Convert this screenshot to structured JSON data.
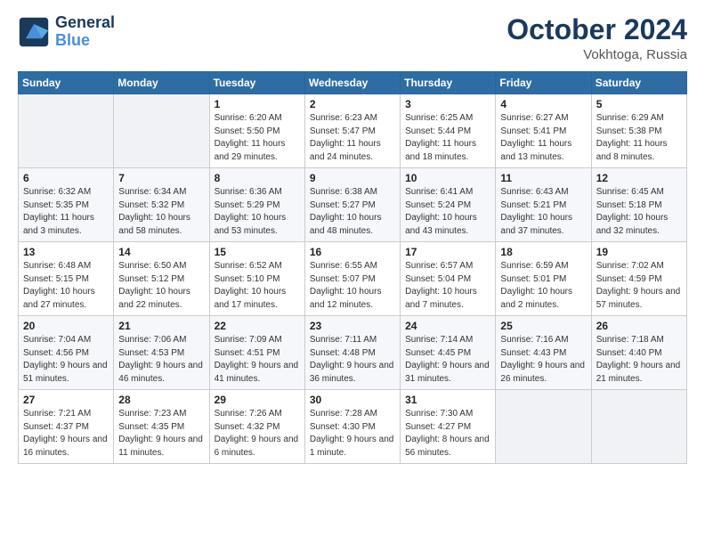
{
  "header": {
    "logo_line1": "General",
    "logo_line2": "Blue",
    "month": "October 2024",
    "location": "Vokhtoga, Russia"
  },
  "days_of_week": [
    "Sunday",
    "Monday",
    "Tuesday",
    "Wednesday",
    "Thursday",
    "Friday",
    "Saturday"
  ],
  "weeks": [
    [
      {
        "num": "",
        "sunrise": "",
        "sunset": "",
        "daylight": ""
      },
      {
        "num": "",
        "sunrise": "",
        "sunset": "",
        "daylight": ""
      },
      {
        "num": "1",
        "sunrise": "Sunrise: 6:20 AM",
        "sunset": "Sunset: 5:50 PM",
        "daylight": "Daylight: 11 hours and 29 minutes."
      },
      {
        "num": "2",
        "sunrise": "Sunrise: 6:23 AM",
        "sunset": "Sunset: 5:47 PM",
        "daylight": "Daylight: 11 hours and 24 minutes."
      },
      {
        "num": "3",
        "sunrise": "Sunrise: 6:25 AM",
        "sunset": "Sunset: 5:44 PM",
        "daylight": "Daylight: 11 hours and 18 minutes."
      },
      {
        "num": "4",
        "sunrise": "Sunrise: 6:27 AM",
        "sunset": "Sunset: 5:41 PM",
        "daylight": "Daylight: 11 hours and 13 minutes."
      },
      {
        "num": "5",
        "sunrise": "Sunrise: 6:29 AM",
        "sunset": "Sunset: 5:38 PM",
        "daylight": "Daylight: 11 hours and 8 minutes."
      }
    ],
    [
      {
        "num": "6",
        "sunrise": "Sunrise: 6:32 AM",
        "sunset": "Sunset: 5:35 PM",
        "daylight": "Daylight: 11 hours and 3 minutes."
      },
      {
        "num": "7",
        "sunrise": "Sunrise: 6:34 AM",
        "sunset": "Sunset: 5:32 PM",
        "daylight": "Daylight: 10 hours and 58 minutes."
      },
      {
        "num": "8",
        "sunrise": "Sunrise: 6:36 AM",
        "sunset": "Sunset: 5:29 PM",
        "daylight": "Daylight: 10 hours and 53 minutes."
      },
      {
        "num": "9",
        "sunrise": "Sunrise: 6:38 AM",
        "sunset": "Sunset: 5:27 PM",
        "daylight": "Daylight: 10 hours and 48 minutes."
      },
      {
        "num": "10",
        "sunrise": "Sunrise: 6:41 AM",
        "sunset": "Sunset: 5:24 PM",
        "daylight": "Daylight: 10 hours and 43 minutes."
      },
      {
        "num": "11",
        "sunrise": "Sunrise: 6:43 AM",
        "sunset": "Sunset: 5:21 PM",
        "daylight": "Daylight: 10 hours and 37 minutes."
      },
      {
        "num": "12",
        "sunrise": "Sunrise: 6:45 AM",
        "sunset": "Sunset: 5:18 PM",
        "daylight": "Daylight: 10 hours and 32 minutes."
      }
    ],
    [
      {
        "num": "13",
        "sunrise": "Sunrise: 6:48 AM",
        "sunset": "Sunset: 5:15 PM",
        "daylight": "Daylight: 10 hours and 27 minutes."
      },
      {
        "num": "14",
        "sunrise": "Sunrise: 6:50 AM",
        "sunset": "Sunset: 5:12 PM",
        "daylight": "Daylight: 10 hours and 22 minutes."
      },
      {
        "num": "15",
        "sunrise": "Sunrise: 6:52 AM",
        "sunset": "Sunset: 5:10 PM",
        "daylight": "Daylight: 10 hours and 17 minutes."
      },
      {
        "num": "16",
        "sunrise": "Sunrise: 6:55 AM",
        "sunset": "Sunset: 5:07 PM",
        "daylight": "Daylight: 10 hours and 12 minutes."
      },
      {
        "num": "17",
        "sunrise": "Sunrise: 6:57 AM",
        "sunset": "Sunset: 5:04 PM",
        "daylight": "Daylight: 10 hours and 7 minutes."
      },
      {
        "num": "18",
        "sunrise": "Sunrise: 6:59 AM",
        "sunset": "Sunset: 5:01 PM",
        "daylight": "Daylight: 10 hours and 2 minutes."
      },
      {
        "num": "19",
        "sunrise": "Sunrise: 7:02 AM",
        "sunset": "Sunset: 4:59 PM",
        "daylight": "Daylight: 9 hours and 57 minutes."
      }
    ],
    [
      {
        "num": "20",
        "sunrise": "Sunrise: 7:04 AM",
        "sunset": "Sunset: 4:56 PM",
        "daylight": "Daylight: 9 hours and 51 minutes."
      },
      {
        "num": "21",
        "sunrise": "Sunrise: 7:06 AM",
        "sunset": "Sunset: 4:53 PM",
        "daylight": "Daylight: 9 hours and 46 minutes."
      },
      {
        "num": "22",
        "sunrise": "Sunrise: 7:09 AM",
        "sunset": "Sunset: 4:51 PM",
        "daylight": "Daylight: 9 hours and 41 minutes."
      },
      {
        "num": "23",
        "sunrise": "Sunrise: 7:11 AM",
        "sunset": "Sunset: 4:48 PM",
        "daylight": "Daylight: 9 hours and 36 minutes."
      },
      {
        "num": "24",
        "sunrise": "Sunrise: 7:14 AM",
        "sunset": "Sunset: 4:45 PM",
        "daylight": "Daylight: 9 hours and 31 minutes."
      },
      {
        "num": "25",
        "sunrise": "Sunrise: 7:16 AM",
        "sunset": "Sunset: 4:43 PM",
        "daylight": "Daylight: 9 hours and 26 minutes."
      },
      {
        "num": "26",
        "sunrise": "Sunrise: 7:18 AM",
        "sunset": "Sunset: 4:40 PM",
        "daylight": "Daylight: 9 hours and 21 minutes."
      }
    ],
    [
      {
        "num": "27",
        "sunrise": "Sunrise: 7:21 AM",
        "sunset": "Sunset: 4:37 PM",
        "daylight": "Daylight: 9 hours and 16 minutes."
      },
      {
        "num": "28",
        "sunrise": "Sunrise: 7:23 AM",
        "sunset": "Sunset: 4:35 PM",
        "daylight": "Daylight: 9 hours and 11 minutes."
      },
      {
        "num": "29",
        "sunrise": "Sunrise: 7:26 AM",
        "sunset": "Sunset: 4:32 PM",
        "daylight": "Daylight: 9 hours and 6 minutes."
      },
      {
        "num": "30",
        "sunrise": "Sunrise: 7:28 AM",
        "sunset": "Sunset: 4:30 PM",
        "daylight": "Daylight: 9 hours and 1 minute."
      },
      {
        "num": "31",
        "sunrise": "Sunrise: 7:30 AM",
        "sunset": "Sunset: 4:27 PM",
        "daylight": "Daylight: 8 hours and 56 minutes."
      },
      {
        "num": "",
        "sunrise": "",
        "sunset": "",
        "daylight": ""
      },
      {
        "num": "",
        "sunrise": "",
        "sunset": "",
        "daylight": ""
      }
    ]
  ]
}
